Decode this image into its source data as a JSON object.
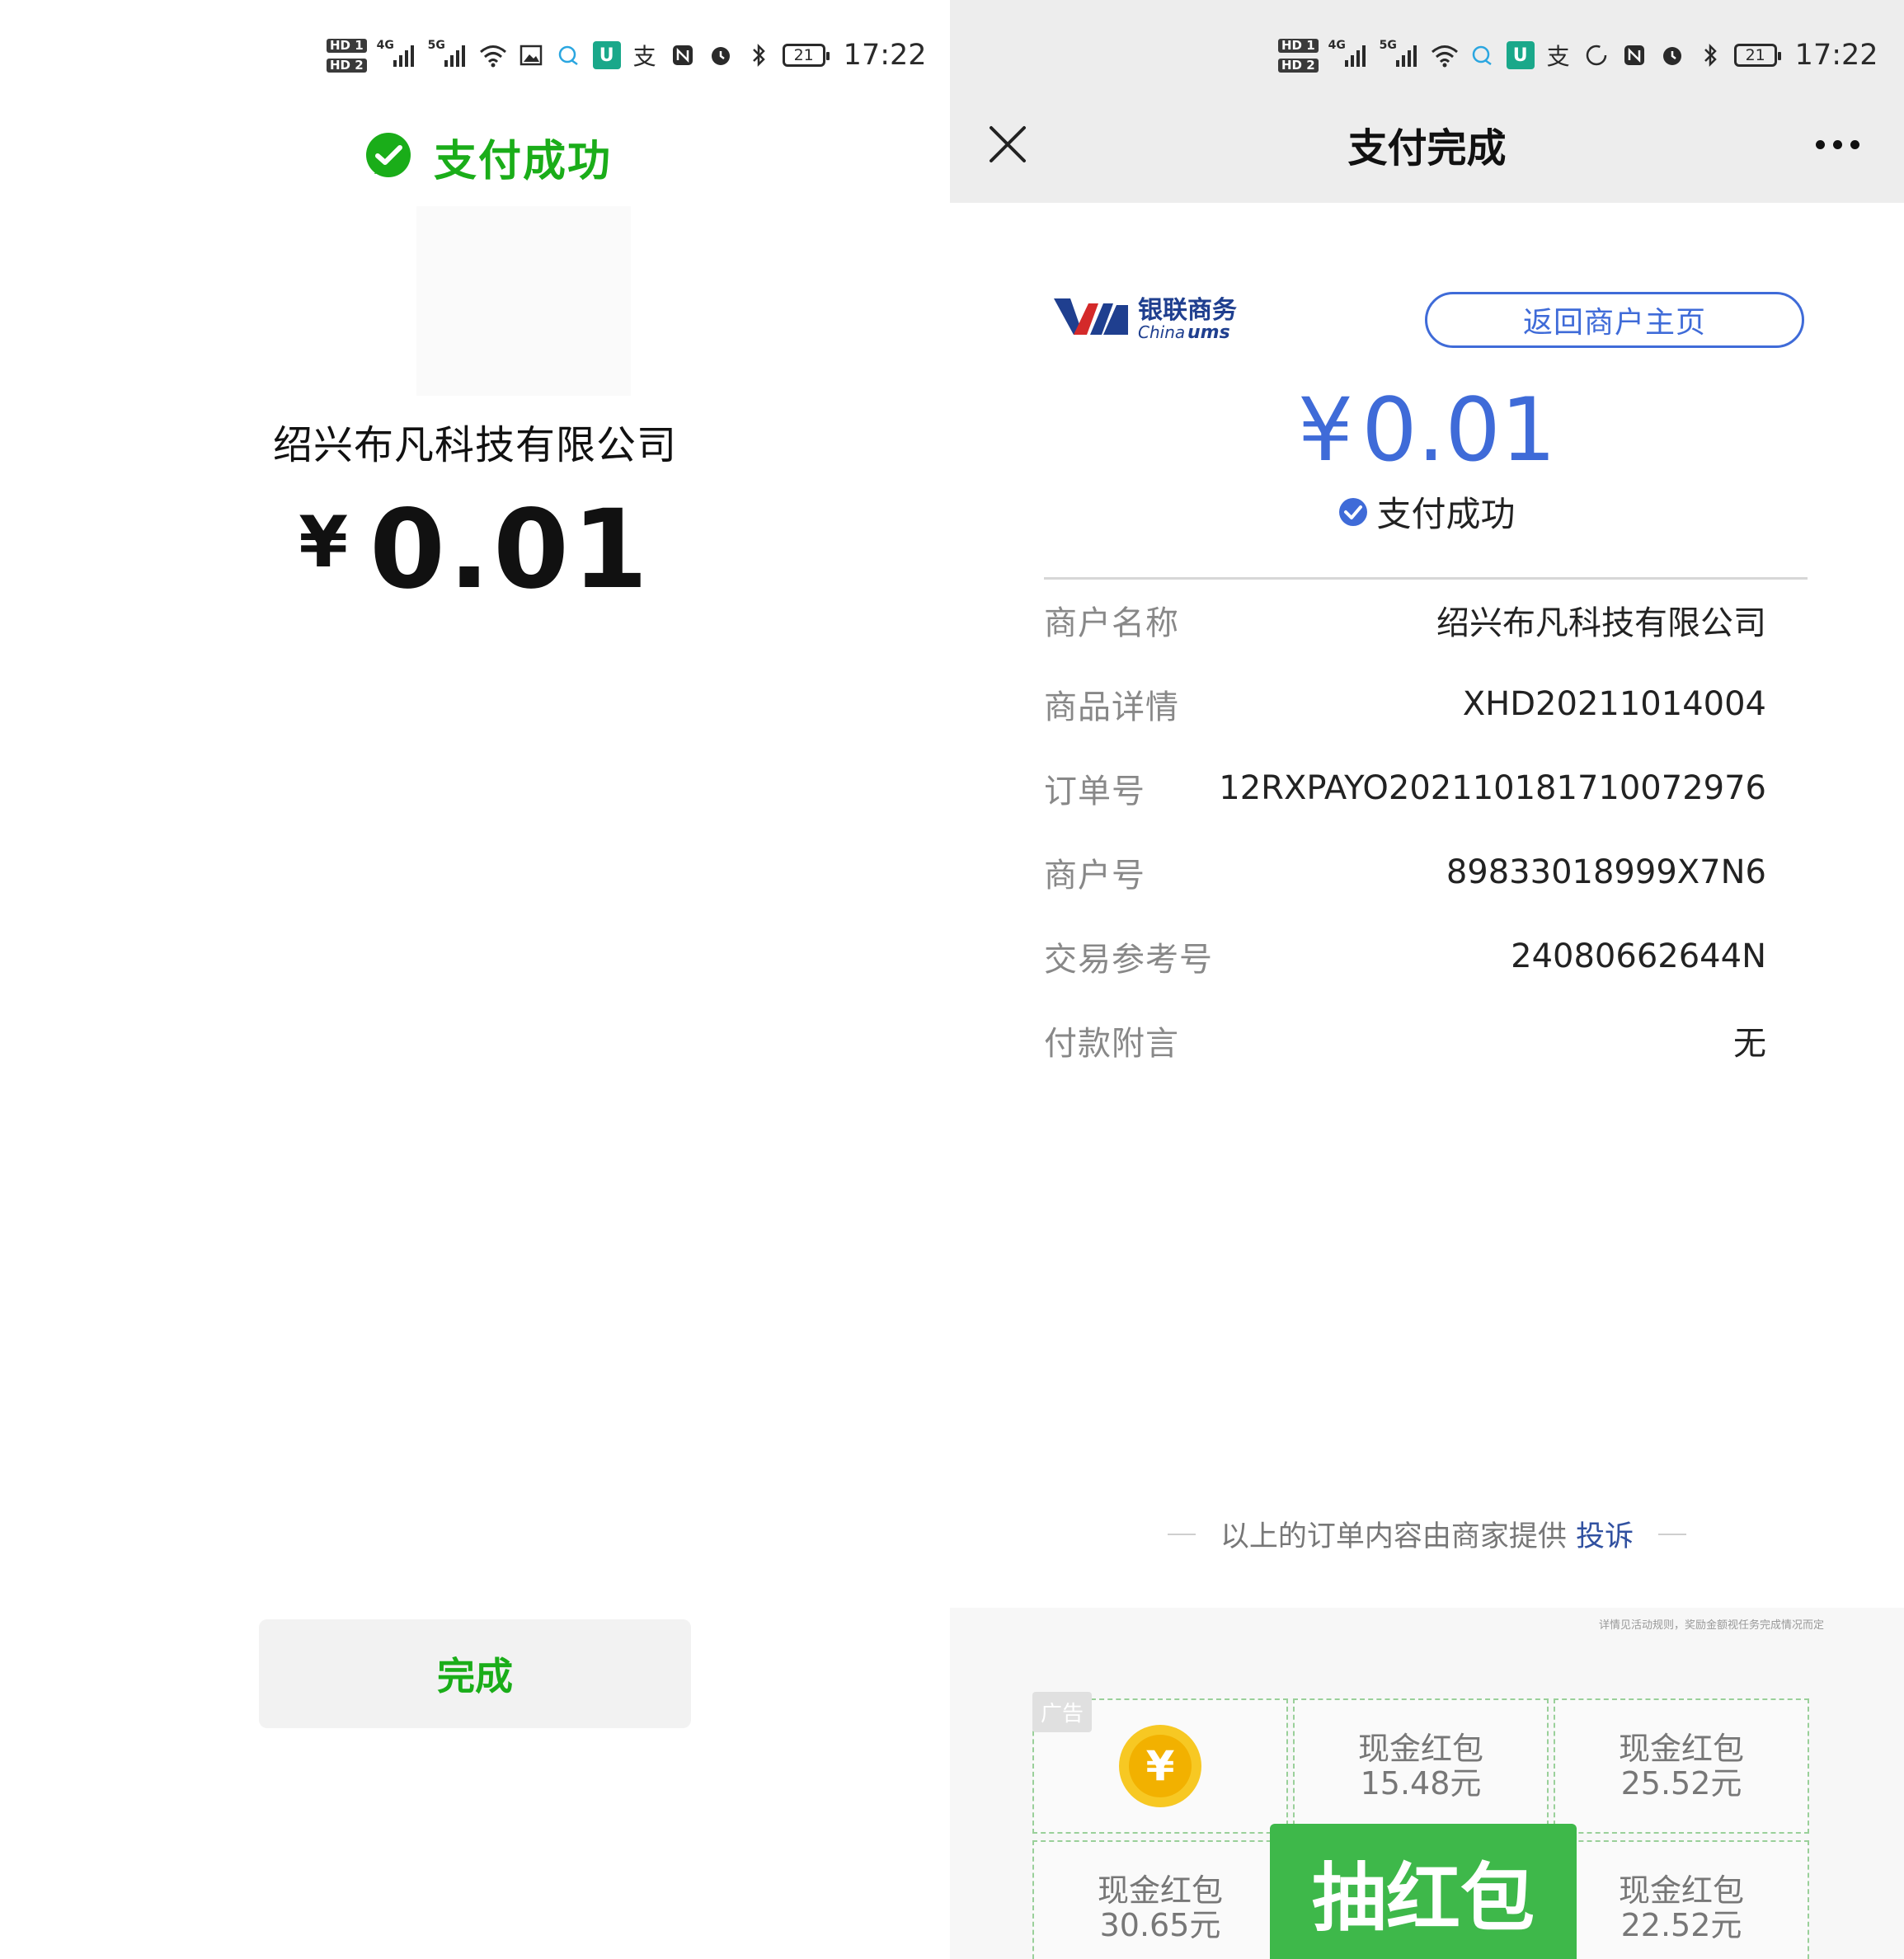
{
  "status_bar": {
    "time": "17:22",
    "battery": "21",
    "net1": "4G",
    "net2": "5G"
  },
  "left": {
    "title": "支付成功",
    "merchant_name": "绍兴布凡科技有限公司",
    "currency": "¥",
    "amount": "0.01",
    "done_label": "完成",
    "brand_color": "#1aad19"
  },
  "right": {
    "page_title": "支付完成",
    "back_home_label": "返回商户主页",
    "currency": "¥",
    "amount": "0.01",
    "status_text": "支付成功",
    "accent_color": "#3f6bd8",
    "details": [
      {
        "label": "商户名称",
        "value": "绍兴布凡科技有限公司"
      },
      {
        "label": "商品详情",
        "value": "XHD20211014004"
      },
      {
        "label": "订单号",
        "value": "12RXPAYO202110181710072976"
      },
      {
        "label": "商户号",
        "value": "89833018999X7N6"
      },
      {
        "label": "交易参考号",
        "value": "24080662644N"
      },
      {
        "label": "付款附言",
        "value": "无"
      }
    ],
    "footnote": "以上的订单内容由商家提供",
    "complain_label": "投诉",
    "ad": {
      "tag": "广告",
      "rules_text": "详情见活动规则，奖励金额视任务完成情况而定",
      "cells": [
        {
          "title": "现金红包",
          "amount": "15.48元"
        },
        {
          "title": "现金红包",
          "amount": "25.52元"
        },
        {
          "title": "现金红包",
          "amount": "30.65元"
        },
        {
          "title": "现金红包",
          "amount": "22.52元"
        }
      ],
      "draw_label": "抽红包"
    }
  },
  "ums_logo": {
    "brand_cn": "银联商务",
    "brand_en_1": "China",
    "brand_en_2": "ums"
  },
  "icons": [
    "wechat-logo-icon",
    "close-icon",
    "more-icon",
    "check-circle-icon",
    "ums-logo-icon",
    "coin-icon",
    "wifi-icon",
    "alarm-icon",
    "bluetooth-icon",
    "nfc-icon",
    "battery-icon"
  ]
}
